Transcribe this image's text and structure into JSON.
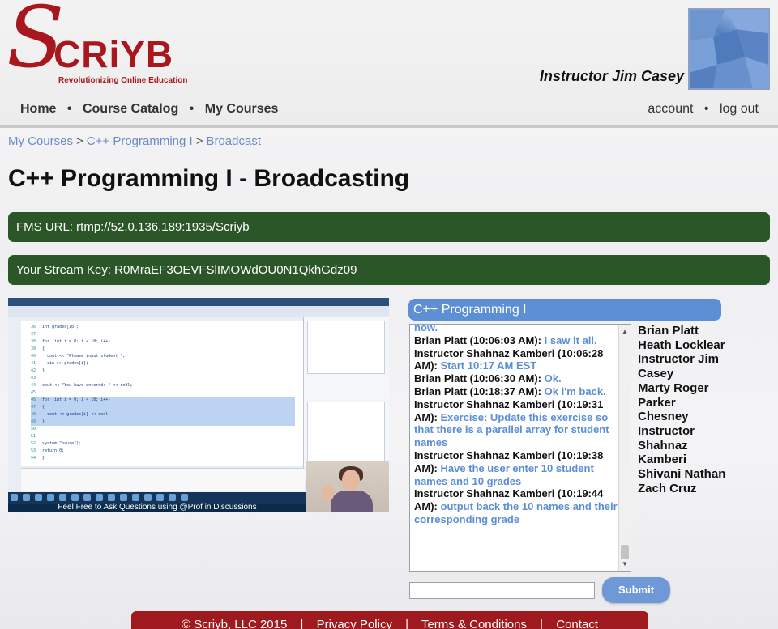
{
  "brand": {
    "logo_s": "S",
    "logo_word": "CRiYB",
    "tagline": "Revolutionizing Online Education"
  },
  "header": {
    "instructor_name": "Instructor Jim Casey"
  },
  "nav": {
    "left": [
      "Home",
      "Course Catalog",
      "My Courses"
    ],
    "right": [
      "account",
      "log out"
    ],
    "separator": "•"
  },
  "breadcrumb": {
    "items": [
      "My Courses",
      "C++ Programming I",
      "Broadcast"
    ],
    "separator": ">"
  },
  "page": {
    "title": "C++ Programming I - Broadcasting",
    "fms_url": "FMS URL: rtmp://52.0.136.189:1935/Scriyb",
    "stream_key": "Your Stream Key: R0MraEF3OEVFSlIMOWdOU0N1QkhGdz09"
  },
  "video": {
    "caption": "Feel Free to Ask Questions using @Prof in Discussions"
  },
  "chat": {
    "title": "C++ Programming I",
    "messages": [
      {
        "name": "",
        "text": "now."
      },
      {
        "name": "Brian Platt (10:06:03 AM): ",
        "text": "I saw it all."
      },
      {
        "name": "Instructor Shahnaz Kamberi (10:06:28 AM): ",
        "text": "Start 10:17 AM EST"
      },
      {
        "name": "Brian Platt (10:06:30 AM): ",
        "text": "Ok."
      },
      {
        "name": "Brian Platt (10:18:37 AM): ",
        "text": "Ok i'm back."
      },
      {
        "name": "Instructor Shahnaz Kamberi (10:19:31 AM): ",
        "text": "Exercise: Update this exercise so that there is a parallel array for student names"
      },
      {
        "name": "Instructor Shahnaz Kamberi (10:19:38 AM): ",
        "text": "Have the user enter 10 student names and 10 grades"
      },
      {
        "name": "Instructor Shahnaz Kamberi (10:19:44 AM): ",
        "text": "output back the 10 names and their corresponding grade"
      }
    ],
    "users": [
      "Brian Platt",
      "Heath Locklear",
      "Instructor Jim Casey",
      "Marty Roger Parker",
      "Chesney",
      "Instructor Shahnaz Kamberi",
      "Shivani Nathan",
      "Zach Cruz"
    ],
    "input_value": "",
    "submit_label": "Submit"
  },
  "footer": {
    "items": [
      "© Scriyb, LLC 2015",
      "Privacy Policy",
      "Terms & Conditions",
      "Contact"
    ],
    "separator": "|"
  },
  "colors": {
    "brand_red": "#a8171e",
    "green_bar": "#2b5628",
    "chat_blue": "#5d8fd4",
    "link_blue": "#6b8bc6"
  }
}
